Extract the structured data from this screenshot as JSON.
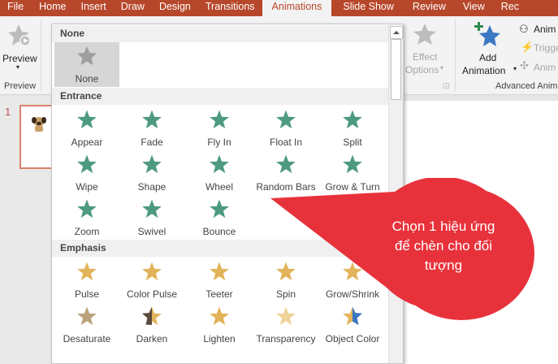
{
  "ribbon_tabs": [
    "File",
    "Home",
    "Insert",
    "Draw",
    "Design",
    "Transitions",
    "Animations",
    "Slide Show",
    "Review",
    "View",
    "Rec"
  ],
  "active_tab_index": 6,
  "ribbon": {
    "preview_label": "Preview",
    "preview_group_label": "Preview",
    "effect_options_line1": "Effect",
    "effect_options_line2": "Options",
    "add_animation_line1": "Add",
    "add_animation_line2": "Animation",
    "advanced_group_label": "Advanced Anim",
    "anim_pane_label": "Anim",
    "trigger_label": "Trigge",
    "anim_painter_label": "Anim"
  },
  "slide_number": "1",
  "gallery": {
    "sections": [
      {
        "title": "None",
        "items": [
          {
            "label": "None",
            "icon": "star-none-icon"
          }
        ]
      },
      {
        "title": "Entrance",
        "items": [
          {
            "label": "Appear",
            "icon": "appear-icon"
          },
          {
            "label": "Fade",
            "icon": "fade-icon"
          },
          {
            "label": "Fly In",
            "icon": "fly-in-icon"
          },
          {
            "label": "Float In",
            "icon": "float-in-icon"
          },
          {
            "label": "Split",
            "icon": "split-icon"
          },
          {
            "label": "Wipe",
            "icon": "wipe-icon"
          },
          {
            "label": "Shape",
            "icon": "shape-icon"
          },
          {
            "label": "Wheel",
            "icon": "wheel-icon"
          },
          {
            "label": "Random Bars",
            "icon": "random-bars-icon"
          },
          {
            "label": "Grow & Turn",
            "icon": "grow-turn-icon"
          },
          {
            "label": "Zoom",
            "icon": "zoom-icon"
          },
          {
            "label": "Swivel",
            "icon": "swivel-icon"
          },
          {
            "label": "Bounce",
            "icon": "bounce-icon"
          }
        ]
      },
      {
        "title": "Emphasis",
        "items": [
          {
            "label": "Pulse",
            "icon": "pulse-icon"
          },
          {
            "label": "Color Pulse",
            "icon": "color-pulse-icon"
          },
          {
            "label": "Teeter",
            "icon": "teeter-icon"
          },
          {
            "label": "Spin",
            "icon": "spin-icon"
          },
          {
            "label": "Grow/Shrink",
            "icon": "grow-shrink-icon"
          },
          {
            "label": "Desaturate",
            "icon": "desaturate-icon"
          },
          {
            "label": "Darken",
            "icon": "darken-icon"
          },
          {
            "label": "Lighten",
            "icon": "lighten-icon"
          },
          {
            "label": "Transparency",
            "icon": "transparency-icon"
          },
          {
            "label": "Object Color",
            "icon": "object-color-icon"
          }
        ]
      }
    ]
  },
  "callout": {
    "text": "Chọn 1 hiệu ứng để chèn cho đối tượng"
  },
  "colors": {
    "brand": "#b7472a",
    "entrance_star": "#4e9a7f",
    "emphasis_star": "#e2b35a",
    "callout": "#e8323b"
  }
}
